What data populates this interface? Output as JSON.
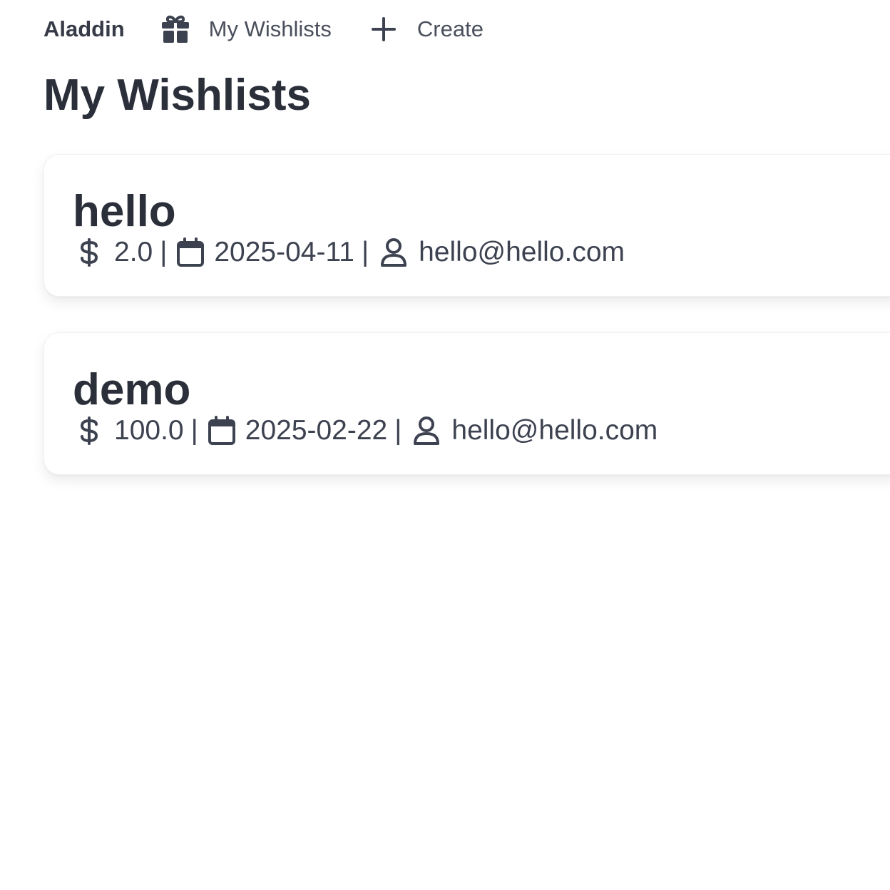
{
  "nav": {
    "brand": "Aladdin",
    "links": [
      {
        "label": "My Wishlists",
        "icon": "gift-icon"
      },
      {
        "label": "Create",
        "icon": "plus-icon"
      }
    ]
  },
  "page": {
    "title": "My Wishlists"
  },
  "wishlists": [
    {
      "title": "hello",
      "amount": "2.0",
      "date": "2025-04-11",
      "owner": "hello@hello.com"
    },
    {
      "title": "demo",
      "amount": "100.0",
      "date": "2025-02-22",
      "owner": "hello@hello.com"
    }
  ],
  "separator": "|",
  "colors": {
    "text": "#2b2f3a",
    "muted": "#4a4f5c",
    "card_bg": "#ffffff"
  }
}
